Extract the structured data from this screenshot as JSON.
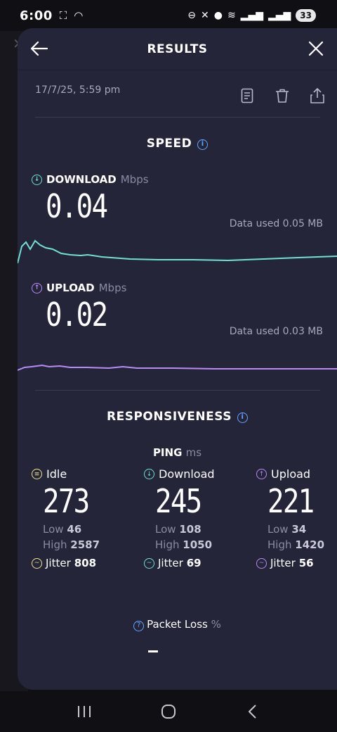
{
  "status_bar": {
    "time": "6:00",
    "battery": "33"
  },
  "header": {
    "title": "RESULTS"
  },
  "result": {
    "date": "17/7/25, 5:59 pm"
  },
  "speed": {
    "section_title": "SPEED",
    "download": {
      "label": "DOWNLOAD",
      "unit": "Mbps",
      "value": "0.04",
      "data_used": "Data used 0.05 MB",
      "color": "#6fe0d2"
    },
    "upload": {
      "label": "UPLOAD",
      "unit": "Mbps",
      "value": "0.02",
      "data_used": "Data used 0.03 MB",
      "color": "#b98cf5"
    }
  },
  "responsiveness": {
    "section_title": "RESPONSIVENESS",
    "ping_label": "PING",
    "ping_unit": "ms",
    "idle": {
      "label": "Idle",
      "value": "273",
      "low_label": "Low",
      "low": "46",
      "high_label": "High",
      "high": "2587",
      "jitter_label": "Jitter",
      "jitter": "808",
      "color": "#efe48c"
    },
    "download": {
      "label": "Download",
      "value": "245",
      "low_label": "Low",
      "low": "108",
      "high_label": "High",
      "high": "1050",
      "jitter_label": "Jitter",
      "jitter": "69",
      "color": "#6fe0d2"
    },
    "upload": {
      "label": "Upload",
      "value": "221",
      "low_label": "Low",
      "low": "34",
      "high_label": "High",
      "high": "1420",
      "jitter_label": "Jitter",
      "jitter": "56",
      "color": "#b98cf5"
    },
    "packet_loss_label": "Packet Loss",
    "packet_loss_unit": "%",
    "packet_loss_value": "–"
  }
}
